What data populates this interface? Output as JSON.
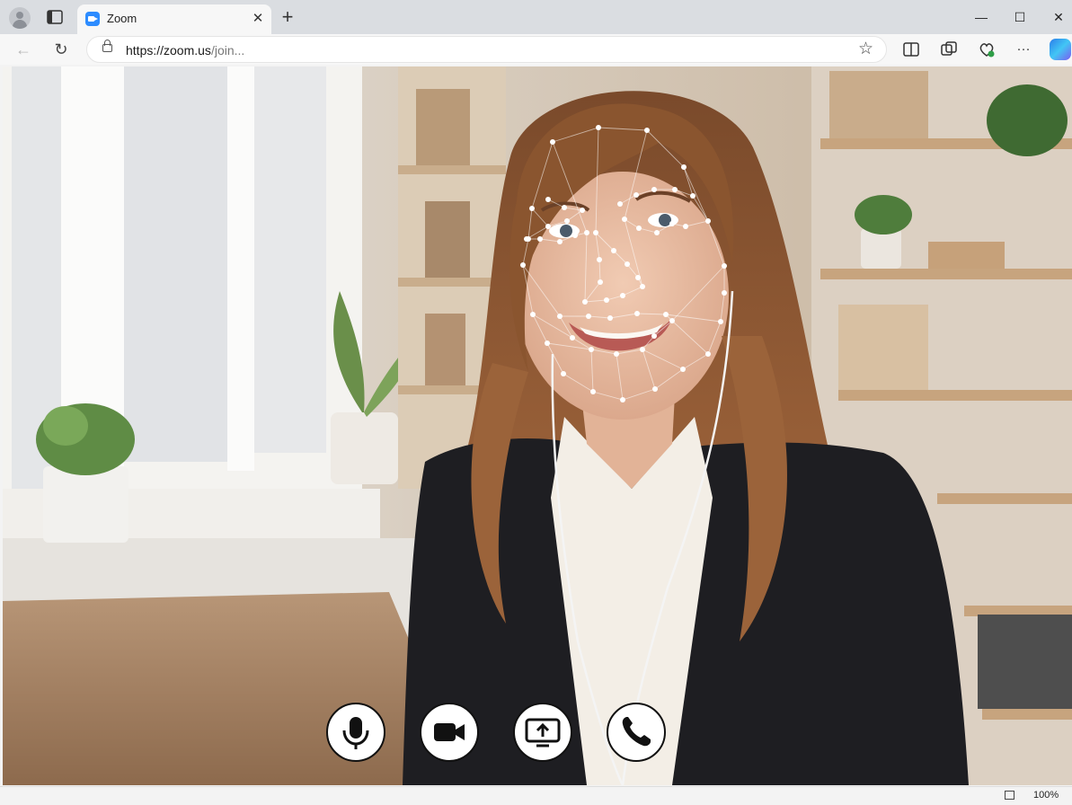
{
  "browser": {
    "tab": {
      "title": "Zoom",
      "close_glyph": "✕",
      "favicon": "zoom-logo-icon"
    },
    "new_tab_glyph": "+",
    "window_controls": {
      "minimize": "—",
      "maximize": "☐",
      "close": "✕"
    },
    "address": {
      "url_main": "https://zoom.us",
      "url_rest": "/join..."
    },
    "nav": {
      "back": "←",
      "reload": "↻",
      "favorite": "☆",
      "more": "···"
    },
    "statusbar": {
      "zoom_level": "100%"
    }
  },
  "meeting": {
    "view": "video feed with face-mesh overlay",
    "controls": [
      {
        "name": "microphone",
        "icon": "microphone-icon"
      },
      {
        "name": "camera",
        "icon": "video-camera-icon"
      },
      {
        "name": "share-screen",
        "icon": "share-screen-icon"
      },
      {
        "name": "leave-call",
        "icon": "phone-icon"
      }
    ]
  },
  "colors": {
    "zoom_blue": "#2d8cff",
    "tab_bar": "#dadde1",
    "mesh_point": "#ffffff"
  }
}
